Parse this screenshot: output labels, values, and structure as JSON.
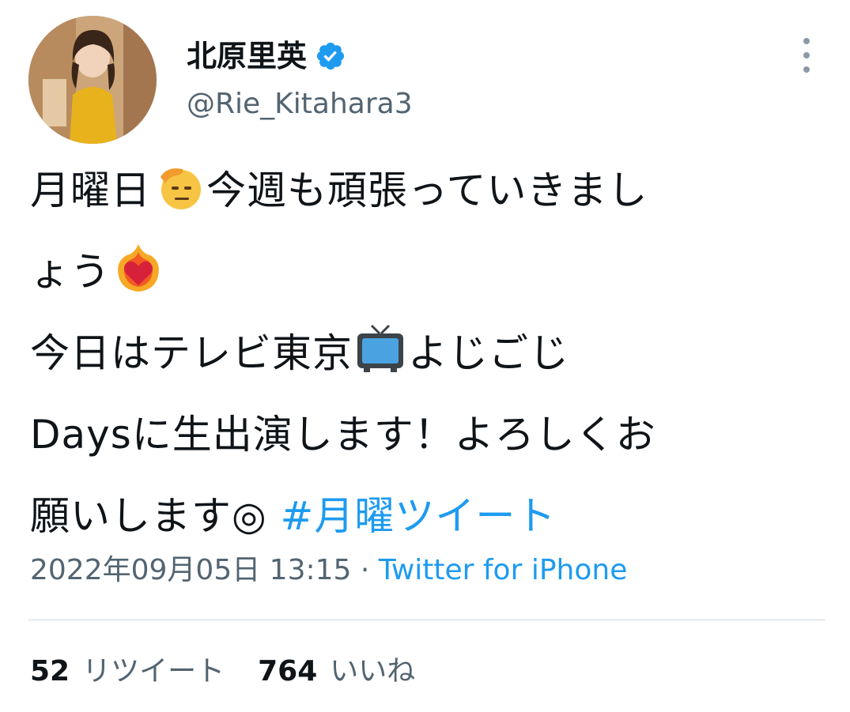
{
  "author": {
    "display_name": "北原里英",
    "handle": "@Rie_Kitahara3",
    "verified": true
  },
  "tweet": {
    "line1_a": "月曜日",
    "line1_emoji": "saluting-face-emoji",
    "line1_b": "今週も頑張っていきまし",
    "line2_a": "ょう",
    "line2_emoji": "heart-on-fire-emoji",
    "line3_a": "今日はテレビ東京",
    "line3_emoji": "television-emoji",
    "line3_b": "よじごじ",
    "line4": "Daysに生出演します！よろしくお",
    "line5_a": "願いします◎ ",
    "hashtag": "#月曜ツイート"
  },
  "meta": {
    "timestamp": "2022年09月05日 13:15",
    "separator": " · ",
    "source": "Twitter for iPhone"
  },
  "stats": {
    "retweets_count": "52",
    "retweets_label": "リツイート",
    "likes_count": "764",
    "likes_label": "いいね"
  },
  "colors": {
    "accent": "#1d9bf0",
    "secondary_text": "#536471",
    "primary_text": "#0f1419",
    "divider": "#cfd9de"
  }
}
